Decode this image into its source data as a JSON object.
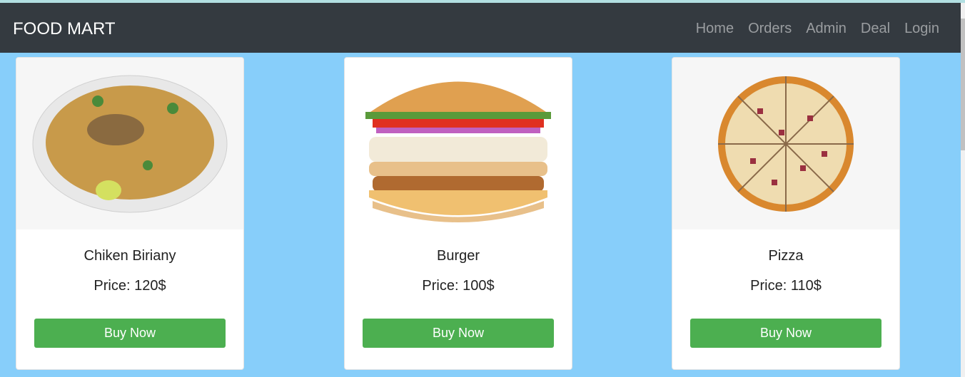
{
  "navbar": {
    "brand": "FOOD MART",
    "links": [
      "Home",
      "Orders",
      "Admin",
      "Deal",
      "Login"
    ]
  },
  "products": [
    {
      "name": "Chiken Biriany",
      "price": "Price: 120$",
      "button": "Buy Now"
    },
    {
      "name": "Burger",
      "price": "Price: 100$",
      "button": "Buy Now"
    },
    {
      "name": "Pizza",
      "price": "Price: 110$",
      "button": "Buy Now"
    }
  ],
  "colors": {
    "navbar": "#343a40",
    "background": "#87cefa",
    "button": "#4caf50"
  }
}
